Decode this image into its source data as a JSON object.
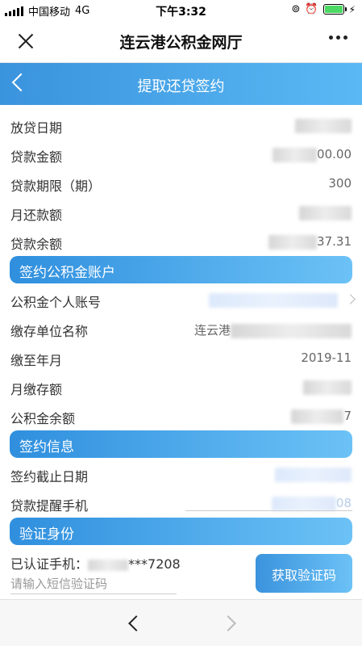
{
  "status": {
    "carrier": "中国移动",
    "network": "4G",
    "time": "下午3:32"
  },
  "titlebar": {
    "title": "连云港公积金网厅"
  },
  "header": {
    "title": "提取还贷签约"
  },
  "loan": {
    "rows": [
      {
        "label": "放贷日期",
        "value": ""
      },
      {
        "label": "贷款金额",
        "value": "00.00"
      },
      {
        "label": "贷款期限（期）",
        "value": "300"
      },
      {
        "label": "月还款额",
        "value": ""
      },
      {
        "label": "贷款余额",
        "value": "37.31"
      }
    ]
  },
  "account": {
    "section_title": "签约公积金账户",
    "account_no_label": "公积金个人账号",
    "employer_label": "缴存单位名称",
    "employer_value": "连云港",
    "paid_until_label": "缴至年月",
    "paid_until_value": "2019-11",
    "monthly_label": "月缴存额",
    "balance_label": "公积金余额",
    "balance_value": "7"
  },
  "sign": {
    "section_title": "签约信息",
    "deadline_label": "签约截止日期",
    "deadline_value": "20  9",
    "phone_label": "贷款提醒手机",
    "phone_value": "08"
  },
  "verify": {
    "section_title": "验证身份",
    "verified_label": "已认证手机：",
    "verified_value": "***7208",
    "sms_placeholder": "请输入短信验证码",
    "sms_button": "获取验证码"
  },
  "colors": {
    "accent": "#3a93dd",
    "accent_light": "#6cc2f6"
  }
}
